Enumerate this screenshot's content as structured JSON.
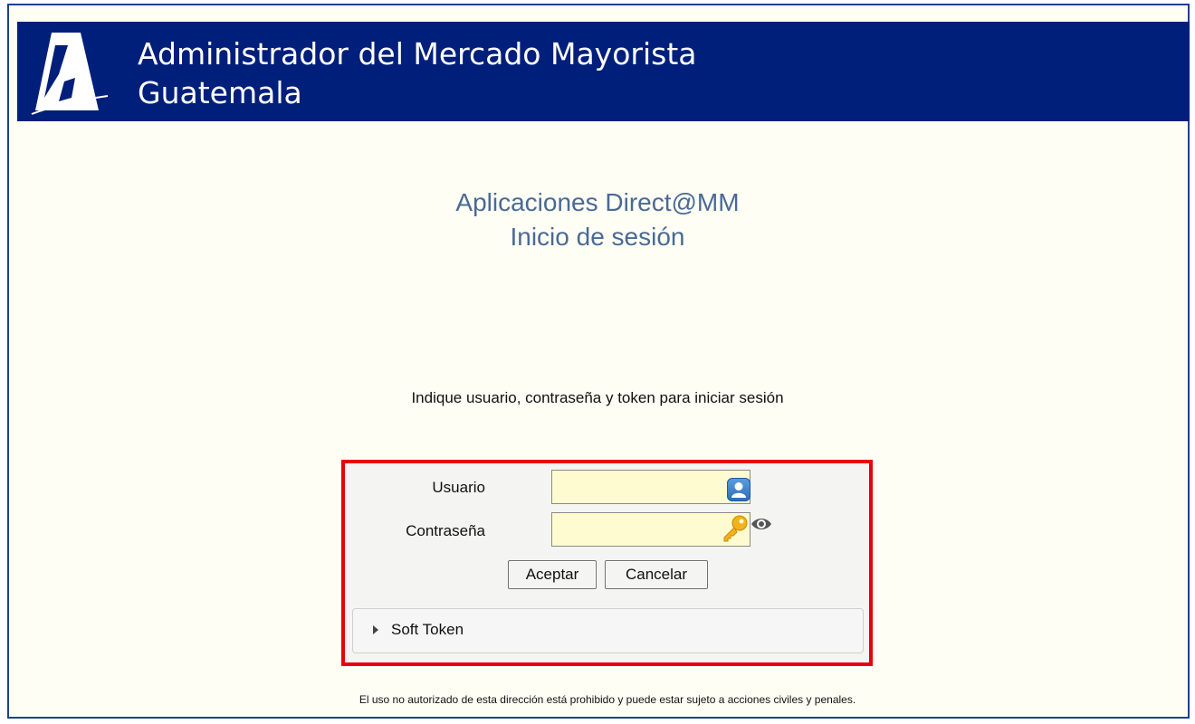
{
  "header": {
    "line1": "Administrador del Mercado Mayorista",
    "line2": "Guatemala"
  },
  "app": {
    "title_line1": "Aplicaciones Direct@MM",
    "title_line2": "Inicio de sesión"
  },
  "instruction": "Indique usuario, contraseña y token para iniciar sesión",
  "login": {
    "user_label": "Usuario",
    "user_value": "",
    "password_label": "Contraseña",
    "password_value": "",
    "accept_label": "Aceptar",
    "cancel_label": "Cancelar"
  },
  "soft_token": {
    "label": "Soft Token",
    "expanded": false
  },
  "footer": "El uso no autorizado de esta dirección está prohibido y puede estar sujeto a acciones civiles y penales.",
  "colors": {
    "header_bg": "#001f7a",
    "page_bg": "#fefef5",
    "title_text": "#4a6a95",
    "highlight_border": "#e8000b",
    "input_bg": "#fffbd0"
  },
  "icons": {
    "logo": "amm-logo",
    "user_field": "user-icon",
    "password_field": "key-icon",
    "show_password": "eye-icon",
    "token_toggle": "triangle-right-icon"
  }
}
